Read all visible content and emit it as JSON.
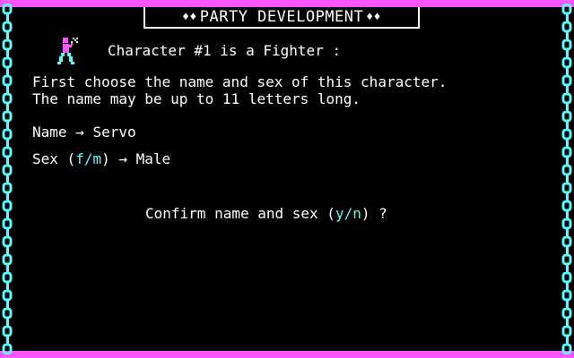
{
  "title": "PARTY DEVELOPMENT",
  "title_ornament": "♦♦",
  "character_line": "Character #1 is a Fighter :",
  "instructions": [
    "First choose the name and sex of this character.",
    "The name may be up to 11 letters long."
  ],
  "name_field": {
    "label": "Name",
    "arrow": "→",
    "value": "Servo"
  },
  "sex_field": {
    "label": "Sex",
    "options_open": "(",
    "options": "f/m",
    "options_close": ")",
    "arrow": "→",
    "value": "Male"
  },
  "confirm": {
    "prompt": "Confirm name and sex",
    "options_open": "(",
    "options": "y/n",
    "options_close": ")",
    "suffix": "?"
  },
  "colors": {
    "background": "#000000",
    "text": "#ffffff",
    "accent_cyan": "#55ffff",
    "accent_magenta": "#ff55ff"
  },
  "icons": {
    "sprite": "fighter-sprite-icon",
    "border": "chain-border"
  }
}
